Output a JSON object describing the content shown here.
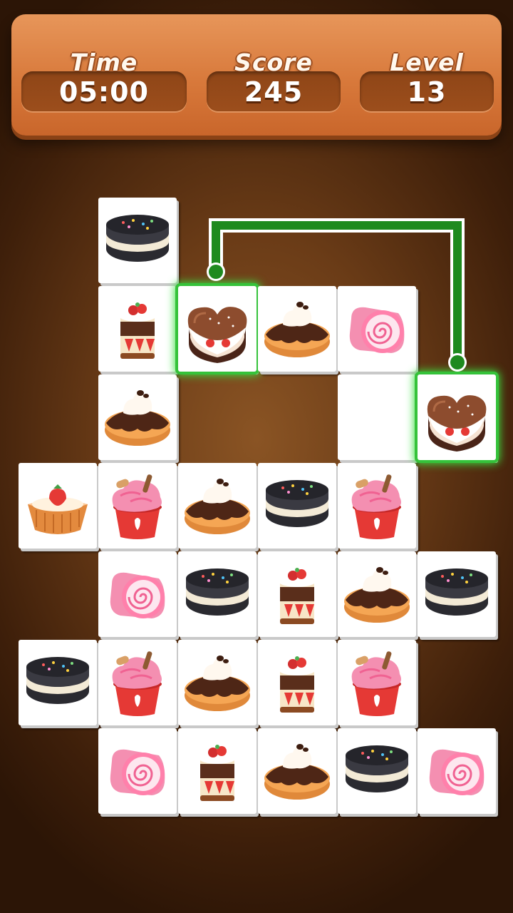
{
  "hud": {
    "time_label": "Time",
    "time_value": "05:00",
    "score_label": "Score",
    "score_value": "245",
    "level_label": "Level",
    "level_value": "13"
  },
  "colors": {
    "background": "#6b3c17",
    "hud_panel": "#d8793b",
    "hud_value_box": "#944a1a",
    "selection_glow": "#35c23a",
    "connector_path": "#1e8a1e"
  },
  "board": {
    "columns": 6,
    "rows": 7,
    "tiles": [
      {
        "row": 0,
        "col": 1,
        "item": "oreo-sandwich"
      },
      {
        "row": 1,
        "col": 1,
        "item": "strawberry-layer-cake"
      },
      {
        "row": 1,
        "col": 2,
        "item": "chocolate-heart-cake",
        "selected": true
      },
      {
        "row": 1,
        "col": 3,
        "item": "cream-donut"
      },
      {
        "row": 1,
        "col": 4,
        "item": "pink-swiss-roll"
      },
      {
        "row": 2,
        "col": 1,
        "item": "cream-donut"
      },
      {
        "row": 2,
        "col": 4,
        "item": "empty"
      },
      {
        "row": 2,
        "col": 5,
        "item": "chocolate-heart-cake",
        "selected": true
      },
      {
        "row": 3,
        "col": 0,
        "item": "strawberry-tart"
      },
      {
        "row": 3,
        "col": 1,
        "item": "strawberry-ice-cream-cup"
      },
      {
        "row": 3,
        "col": 2,
        "item": "cream-donut"
      },
      {
        "row": 3,
        "col": 3,
        "item": "oreo-sandwich"
      },
      {
        "row": 3,
        "col": 4,
        "item": "strawberry-ice-cream-cup"
      },
      {
        "row": 4,
        "col": 1,
        "item": "pink-swiss-roll"
      },
      {
        "row": 4,
        "col": 2,
        "item": "oreo-sandwich"
      },
      {
        "row": 4,
        "col": 3,
        "item": "strawberry-layer-cake"
      },
      {
        "row": 4,
        "col": 4,
        "item": "cream-donut"
      },
      {
        "row": 4,
        "col": 5,
        "item": "oreo-sandwich"
      },
      {
        "row": 5,
        "col": 0,
        "item": "oreo-sandwich"
      },
      {
        "row": 5,
        "col": 1,
        "item": "strawberry-ice-cream-cup"
      },
      {
        "row": 5,
        "col": 2,
        "item": "cream-donut"
      },
      {
        "row": 5,
        "col": 3,
        "item": "strawberry-layer-cake"
      },
      {
        "row": 5,
        "col": 4,
        "item": "strawberry-ice-cream-cup"
      },
      {
        "row": 6,
        "col": 1,
        "item": "pink-swiss-roll"
      },
      {
        "row": 6,
        "col": 2,
        "item": "strawberry-layer-cake"
      },
      {
        "row": 6,
        "col": 3,
        "item": "cream-donut"
      },
      {
        "row": 6,
        "col": 4,
        "item": "oreo-sandwich"
      },
      {
        "row": 6,
        "col": 5,
        "item": "pink-swiss-roll"
      }
    ]
  }
}
